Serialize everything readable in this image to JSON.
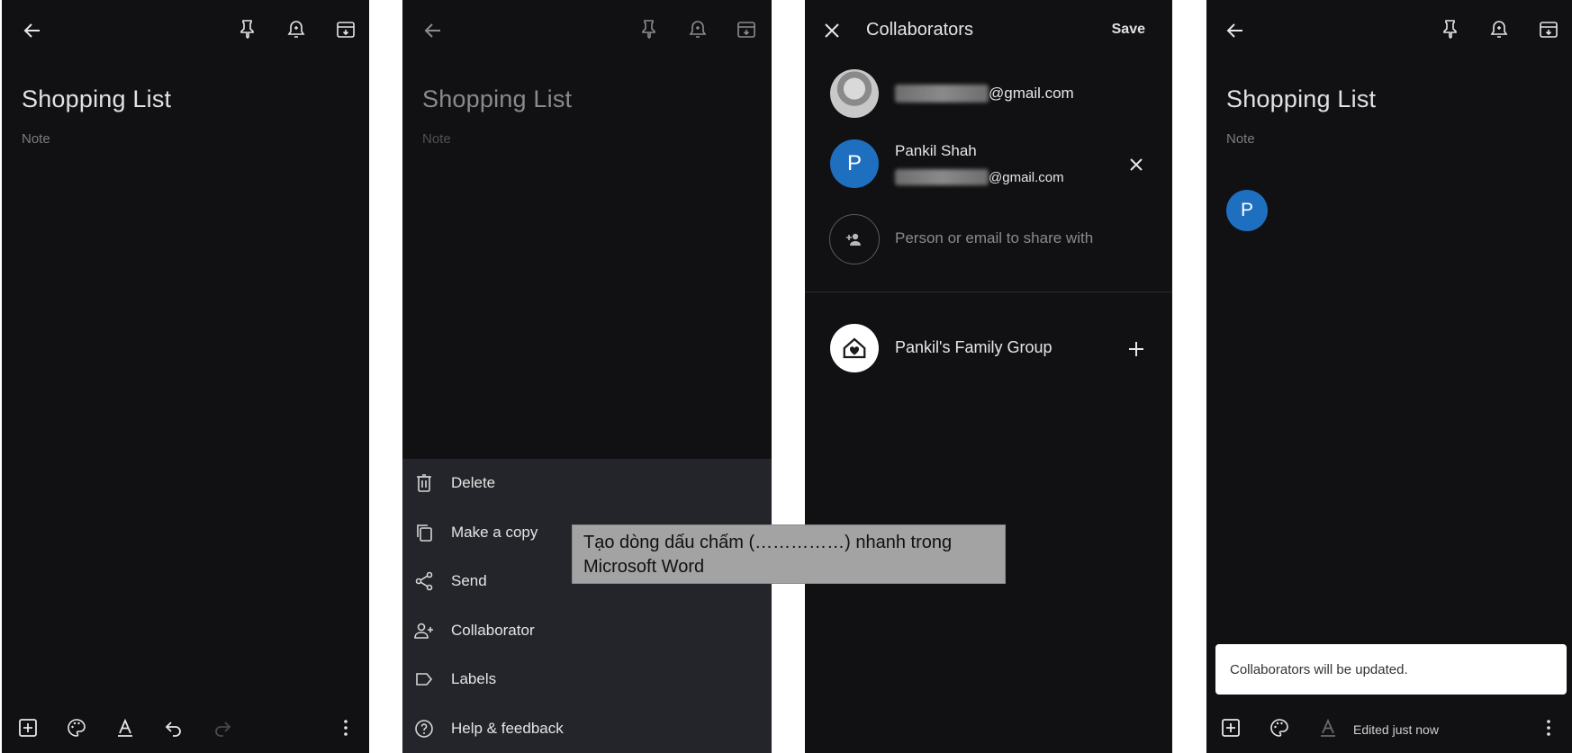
{
  "panel1": {
    "title": "Shopping List",
    "note_placeholder": "Note"
  },
  "panel2": {
    "title": "Shopping List",
    "note_placeholder": "Note",
    "menu": [
      {
        "label": "Delete",
        "icon": "trash-icon"
      },
      {
        "label": "Make a copy",
        "icon": "copy-icon"
      },
      {
        "label": "Send",
        "icon": "share-icon"
      },
      {
        "label": "Collaborator",
        "icon": "person-add-icon"
      },
      {
        "label": "Labels",
        "icon": "label-icon"
      },
      {
        "label": "Help & feedback",
        "icon": "help-icon"
      }
    ]
  },
  "panel3": {
    "title": "Collaborators",
    "save_label": "Save",
    "owner_email_domain": "@gmail.com",
    "collaborator_initial": "P",
    "collaborator_name": "Pankil Shah",
    "collaborator_email_domain": "@gmail.com",
    "add_placeholder": "Person or email to share with",
    "group_name": "Pankil's Family Group"
  },
  "panel4": {
    "title": "Shopping List",
    "note_placeholder": "Note",
    "avatar_initial": "P",
    "snackbar_text": "Collaborators will be updated.",
    "edited_text": "Edited just now"
  },
  "tooltip": {
    "line1": "Tạo dòng dấu chấm (……………) nhanh trong",
    "line2": "Microsoft Word"
  },
  "colors": {
    "panel_bg": "#111114",
    "menu_bg": "#24252b",
    "avatar_blue": "#1f6fc0"
  }
}
